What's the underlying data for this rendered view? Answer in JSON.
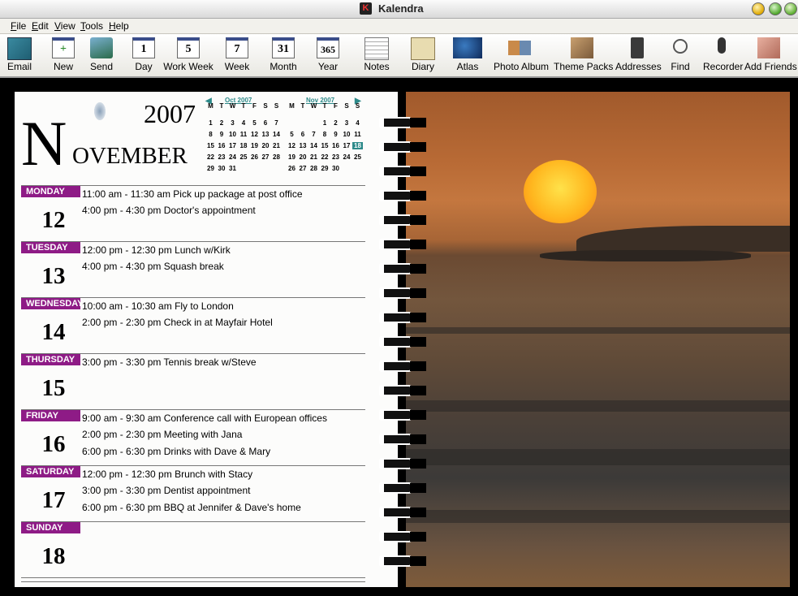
{
  "window": {
    "title": "Kalendra",
    "app_icon": "K"
  },
  "menu": [
    "File",
    "Edit",
    "View",
    "Tools",
    "Help"
  ],
  "toolbar": [
    {
      "id": "email",
      "label": "Email",
      "icon": "email-icon"
    },
    {
      "id": "new",
      "label": "New",
      "icon": "new-icon"
    },
    {
      "id": "send",
      "label": "Send",
      "icon": "send-icon"
    },
    {
      "id": "day",
      "label": "Day",
      "icon": "day-view-icon",
      "glyph": "1"
    },
    {
      "id": "work-week",
      "label": "Work Week",
      "icon": "work-week-icon",
      "glyph": "5"
    },
    {
      "id": "week",
      "label": "Week",
      "icon": "week-icon",
      "glyph": "7"
    },
    {
      "id": "month",
      "label": "Month",
      "icon": "month-icon",
      "glyph": "31"
    },
    {
      "id": "year",
      "label": "Year",
      "icon": "year-icon",
      "glyph": "365"
    },
    {
      "id": "notes",
      "label": "Notes",
      "icon": "notes-icon"
    },
    {
      "id": "diary",
      "label": "Diary",
      "icon": "diary-icon"
    },
    {
      "id": "atlas",
      "label": "Atlas",
      "icon": "atlas-icon"
    },
    {
      "id": "photo-album",
      "label": "Photo Album",
      "icon": "photo-album-icon"
    },
    {
      "id": "theme-packs",
      "label": "Theme Packs",
      "icon": "theme-packs-icon"
    },
    {
      "id": "addresses",
      "label": "Addresses",
      "icon": "address-book-icon"
    },
    {
      "id": "find",
      "label": "Find",
      "icon": "magnifier-icon"
    },
    {
      "id": "recorder",
      "label": "Recorder",
      "icon": "microphone-icon"
    },
    {
      "id": "add-friends",
      "label": "Add Friends",
      "icon": "add-friends-icon"
    }
  ],
  "planner": {
    "year": "2007",
    "month_initial": "N",
    "month_rest": "OVEMBER",
    "mini_calendars": [
      {
        "title": "Oct 2007",
        "dow": [
          "M",
          "T",
          "W",
          "T",
          "F",
          "S",
          "S"
        ],
        "weeks": [
          [
            "1",
            "2",
            "3",
            "4",
            "5",
            "6",
            "7"
          ],
          [
            "8",
            "9",
            "10",
            "11",
            "12",
            "13",
            "14"
          ],
          [
            "15",
            "16",
            "17",
            "18",
            "19",
            "20",
            "21"
          ],
          [
            "22",
            "23",
            "24",
            "25",
            "26",
            "27",
            "28"
          ],
          [
            "29",
            "30",
            "31",
            "",
            "",
            "",
            ""
          ]
        ]
      },
      {
        "title": "Nov 2007",
        "dow": [
          "M",
          "T",
          "W",
          "T",
          "F",
          "S",
          "S"
        ],
        "weeks": [
          [
            "",
            "",
            "",
            "1",
            "2",
            "3",
            "4"
          ],
          [
            "5",
            "6",
            "7",
            "8",
            "9",
            "10",
            "11"
          ],
          [
            "12",
            "13",
            "14",
            "15",
            "16",
            "17",
            "18"
          ],
          [
            "19",
            "20",
            "21",
            "22",
            "23",
            "24",
            "25"
          ],
          [
            "26",
            "27",
            "28",
            "29",
            "30",
            "",
            ""
          ]
        ],
        "highlight": "18"
      }
    ],
    "days": [
      {
        "name": "MONDAY",
        "number": "12",
        "events": [
          "11:00 am - 11:30 am Pick up package at post office",
          "4:00 pm - 4:30 pm Doctor's appointment"
        ]
      },
      {
        "name": "TUESDAY",
        "number": "13",
        "events": [
          "12:00 pm - 12:30 pm Lunch w/Kirk",
          "4:00 pm - 4:30 pm Squash break"
        ]
      },
      {
        "name": "WEDNESDAY",
        "number": "14",
        "events": [
          "10:00 am - 10:30 am Fly to London",
          "2:00 pm - 2:30 pm Check in at Mayfair Hotel"
        ]
      },
      {
        "name": "THURSDAY",
        "number": "15",
        "events": [
          "3:00 pm - 3:30 pm Tennis break w/Steve"
        ]
      },
      {
        "name": "FRIDAY",
        "number": "16",
        "events": [
          "9:00 am - 9:30 am Conference call with European offices",
          "2:00 pm - 2:30 pm Meeting with Jana",
          "6:00 pm - 6:30 pm Drinks with Dave & Mary"
        ]
      },
      {
        "name": "SATURDAY",
        "number": "17",
        "events": [
          "12:00 pm - 12:30 pm Brunch with Stacy",
          "3:00 pm - 3:30 pm Dentist appointment",
          "6:00 pm - 6:30 pm BBQ at Jennifer & Dave's home"
        ]
      },
      {
        "name": "SUNDAY",
        "number": "18",
        "events": []
      }
    ],
    "colors": {
      "day_band": "#8e1b86",
      "mini_accent": "#2d8a8a"
    }
  }
}
